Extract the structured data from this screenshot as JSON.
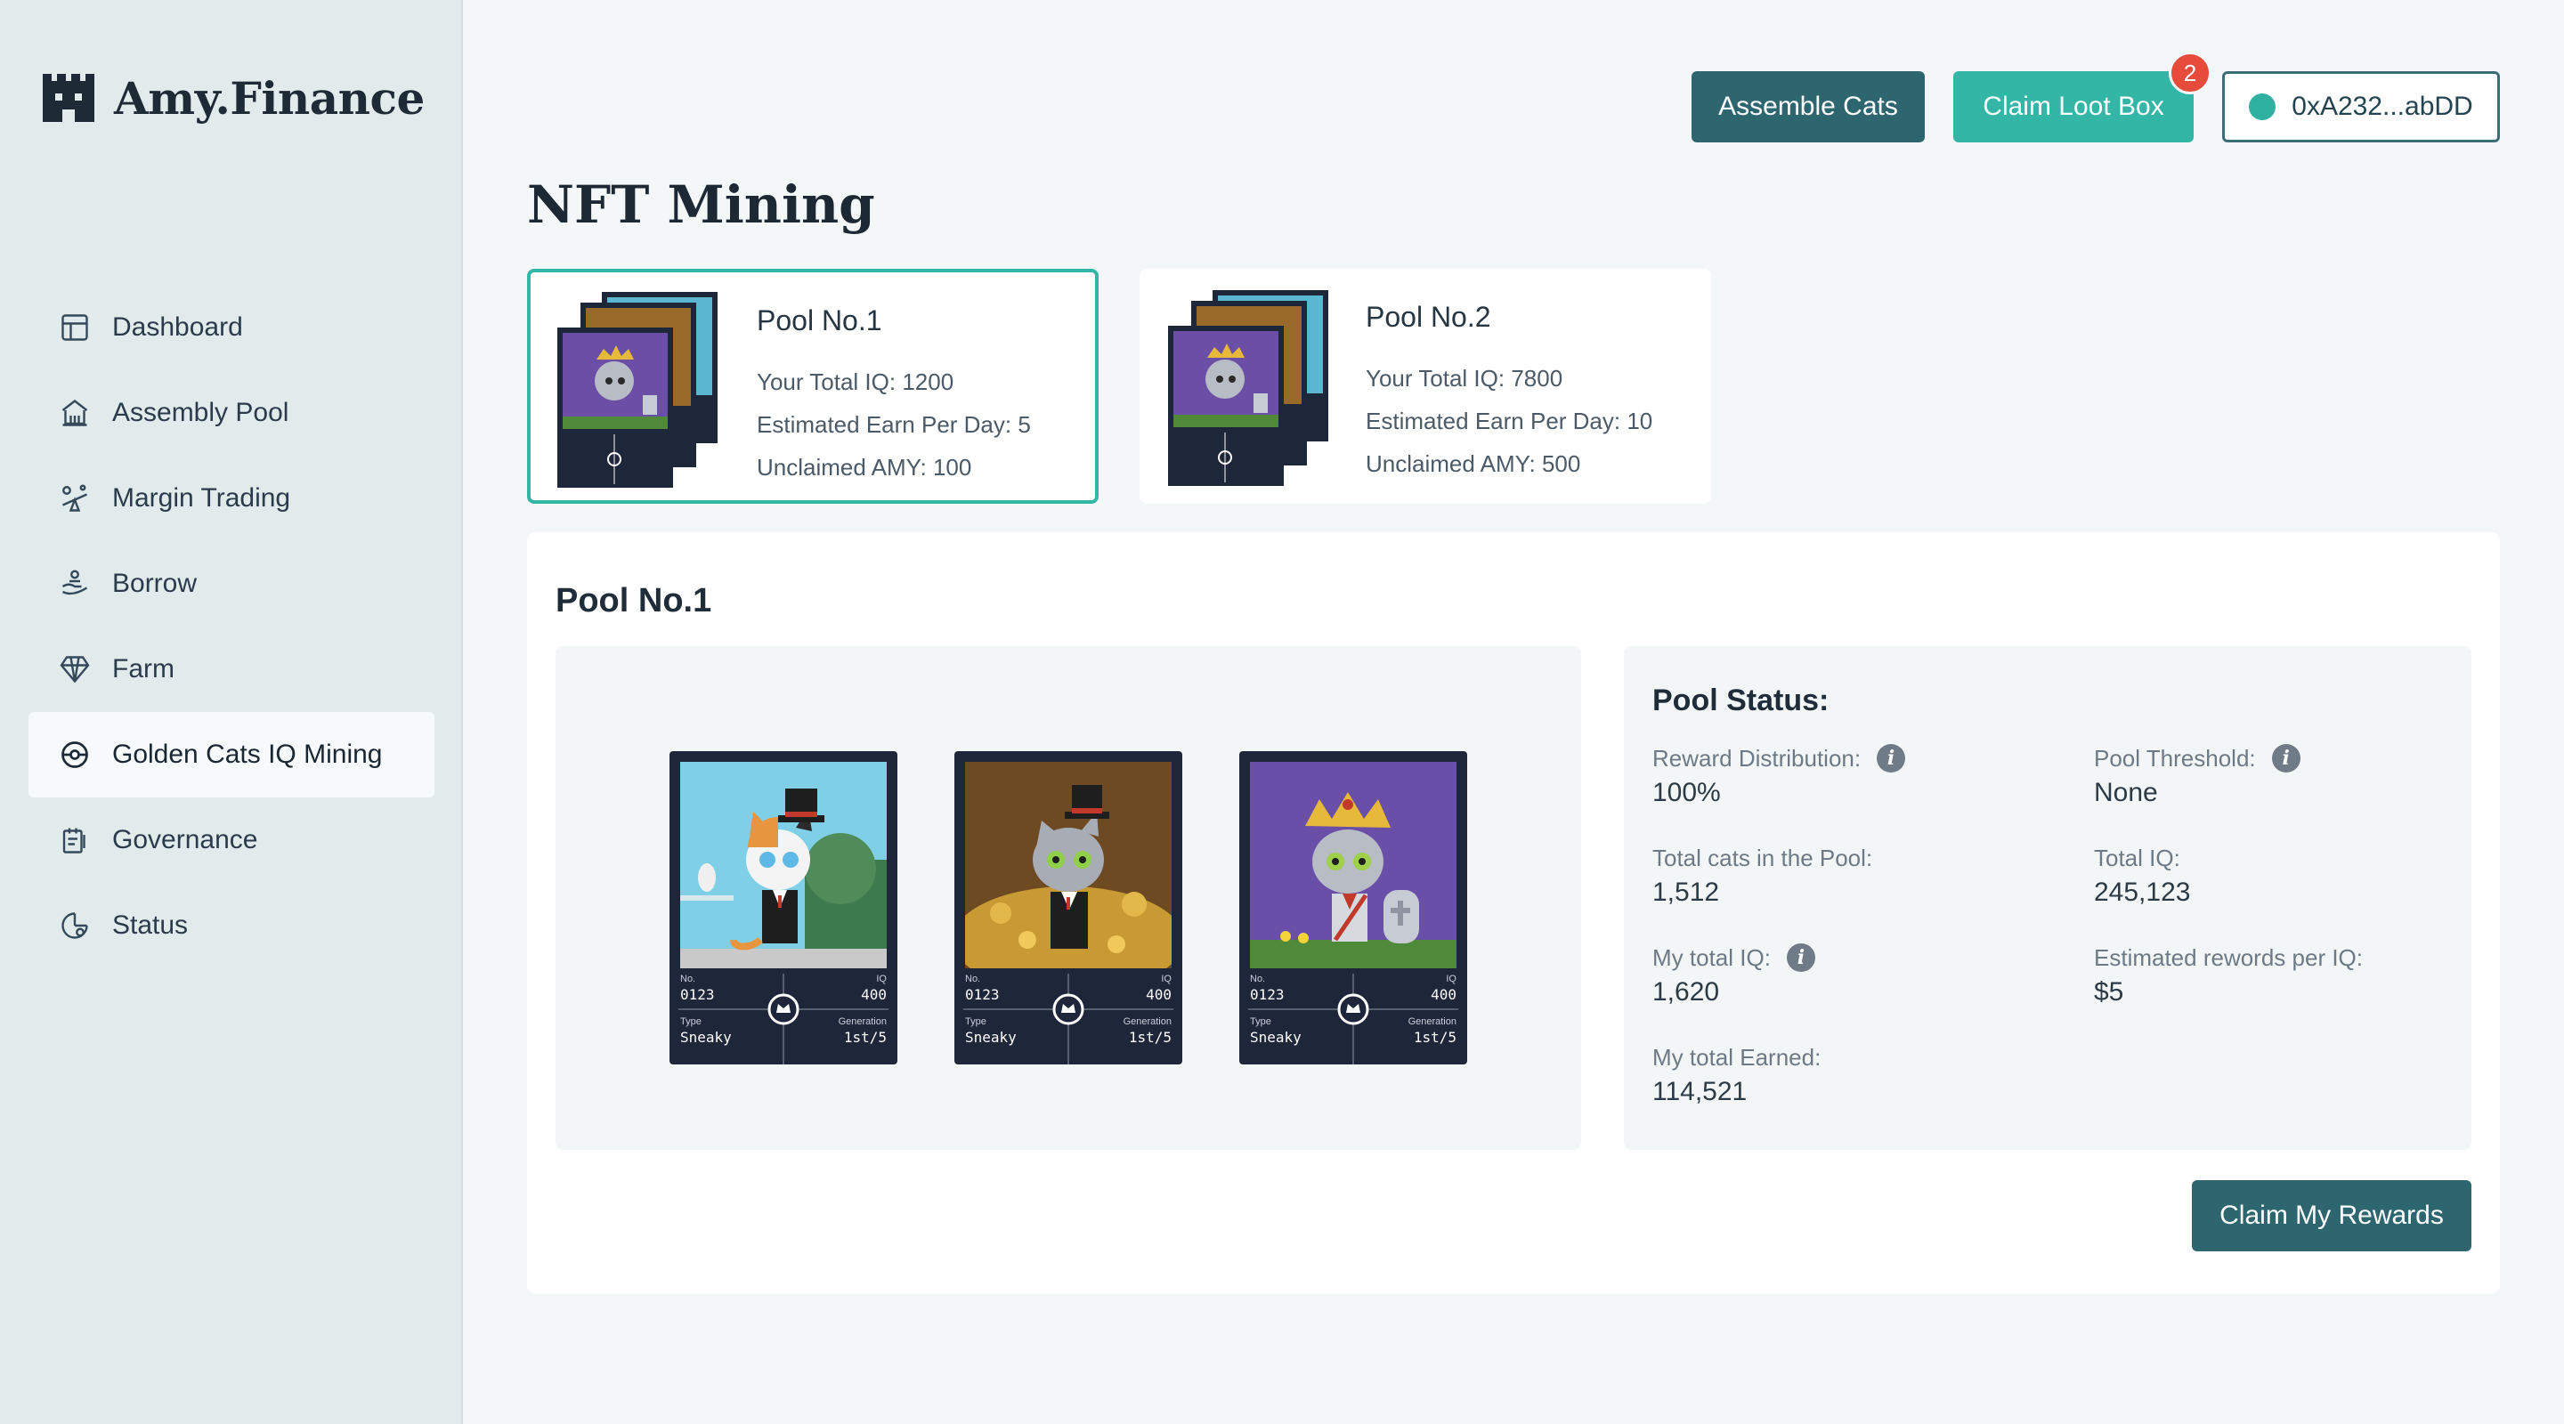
{
  "app": {
    "name": "Amy.Finance"
  },
  "sidebar": {
    "items": [
      {
        "label": "Dashboard",
        "icon": "dashboard-icon"
      },
      {
        "label": "Assembly Pool",
        "icon": "bank-icon"
      },
      {
        "label": "Margin Trading",
        "icon": "seesaw-icon"
      },
      {
        "label": "Borrow",
        "icon": "hand-coins-icon"
      },
      {
        "label": "Farm",
        "icon": "diamond-icon"
      },
      {
        "label": "Golden Cats IQ Mining",
        "icon": "pokeball-icon",
        "active": true
      },
      {
        "label": "Governance",
        "icon": "governance-icon"
      },
      {
        "label": "Status",
        "icon": "status-icon"
      }
    ]
  },
  "header": {
    "assemble_label": "Assemble Cats",
    "loot_label": "Claim Loot Box",
    "loot_badge": "2",
    "wallet_address": "0xA232...abDD"
  },
  "page": {
    "title": "NFT Mining"
  },
  "pools": [
    {
      "name": "Pool No.1",
      "iq": "Your Total IQ: 1200",
      "earn": "Estimated Earn Per Day: 5",
      "unclaimed": "Unclaimed AMY: 100",
      "selected": true
    },
    {
      "name": "Pool No.2",
      "iq": "Your Total IQ: 7800",
      "earn": "Estimated Earn Per Day: 10",
      "unclaimed": "Unclaimed AMY: 500",
      "selected": false
    }
  ],
  "panel": {
    "title": "Pool No.1",
    "cards": [
      {
        "no_label": "No.",
        "no": "0123",
        "iq_label": "IQ",
        "iq": "400",
        "type_label": "Type",
        "type": "Sneaky",
        "gen_label": "Generation",
        "gen": "1st/5"
      },
      {
        "no_label": "No.",
        "no": "0123",
        "iq_label": "IQ",
        "iq": "400",
        "type_label": "Type",
        "type": "Sneaky",
        "gen_label": "Generation",
        "gen": "1st/5"
      },
      {
        "no_label": "No.",
        "no": "0123",
        "iq_label": "IQ",
        "iq": "400",
        "type_label": "Type",
        "type": "Sneaky",
        "gen_label": "Generation",
        "gen": "1st/5"
      }
    ],
    "status": {
      "title": "Pool Status:",
      "reward_distribution_label": "Reward Distribution:",
      "reward_distribution": "100%",
      "threshold_label": "Pool Threshold:",
      "threshold": "None",
      "total_cats_label": "Total cats in the Pool:",
      "total_cats": "1,512",
      "total_iq_label": "Total IQ:",
      "total_iq": "245,123",
      "my_iq_label": "My total IQ:",
      "my_iq": "1,620",
      "est_rewards_label": "Estimated rewords per IQ:",
      "est_rewards": "$5",
      "my_earned_label": "My total Earned:",
      "my_earned": "114,521"
    },
    "claim_label": "Claim My Rewards"
  },
  "colors": {
    "primary": "#2e6670",
    "accent": "#34b6a6",
    "badge": "#e64b3c"
  }
}
